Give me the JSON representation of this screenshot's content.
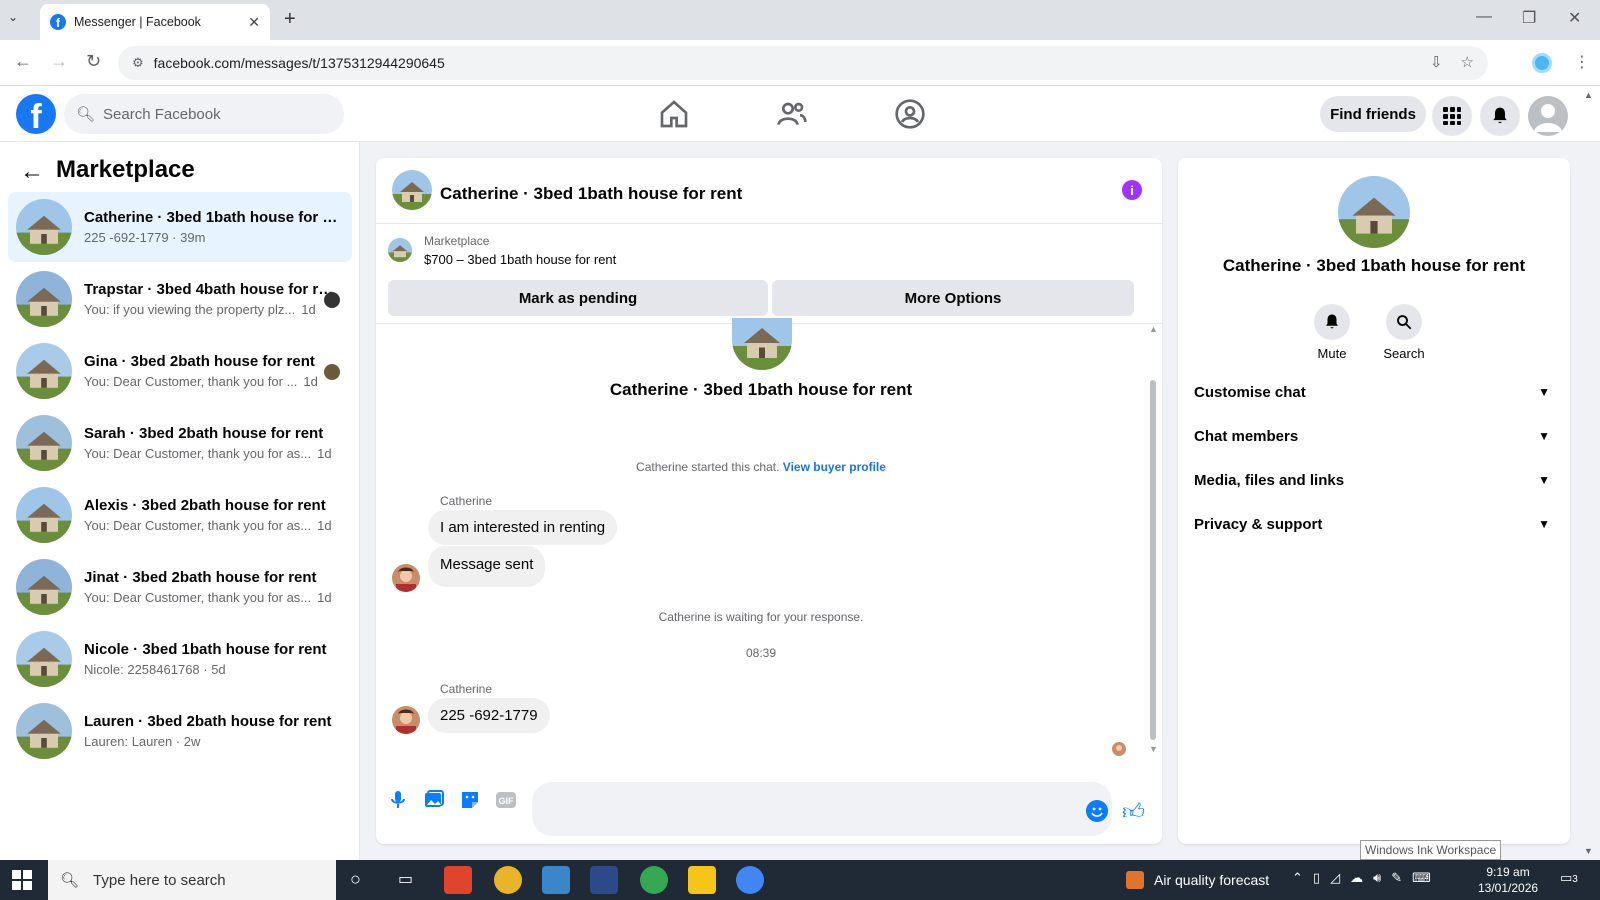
{
  "browser": {
    "tab_title": "Messenger | Facebook",
    "url": "facebook.com/messages/t/1375312944290645"
  },
  "fb": {
    "search_placeholder": "Search Facebook",
    "find_friends": "Find friends"
  },
  "marketplace": {
    "title": "Marketplace",
    "conversations": [
      {
        "name": "Catherine · 3bed 1bath house for rent",
        "preview": "225 -692-1779 · 39m"
      },
      {
        "name": "Trapstar · 3bed 4bath house for rent",
        "preview": "You: if you viewing the property plz...",
        "time": "1d"
      },
      {
        "name": "Gina · 3bed 2bath house for rent",
        "preview": "You: Dear Customer, thank you for ...",
        "time": "1d"
      },
      {
        "name": "Sarah · 3bed 2bath house for rent",
        "preview": "You: Dear Customer, thank you for as...",
        "time": "1d"
      },
      {
        "name": "Alexis · 3bed 2bath house for rent",
        "preview": "You: Dear Customer, thank you for as...",
        "time": "1d"
      },
      {
        "name": "Jinat · 3bed 2bath house for rent",
        "preview": "You: Dear Customer, thank you for as...",
        "time": "1d"
      },
      {
        "name": "Nicole · 3bed 1bath house for rent",
        "preview": "Nicole: 2258461768 · 5d"
      },
      {
        "name": "Lauren · 3bed 2bath house for rent",
        "preview": "Lauren: Lauren · 2w"
      }
    ]
  },
  "chat": {
    "title": "Catherine · 3bed 1bath house for rent",
    "listing_label": "Marketplace",
    "listing_price": "$700 – 3bed 1bath house for rent",
    "btn_pending": "Mark as pending",
    "btn_more": "More Options",
    "started_text": "Catherine started this chat.",
    "view_buyer": "View buyer profile",
    "sender1": "Catherine",
    "msg1": "I am interested in renting",
    "msg2": "Message sent",
    "waiting": "Catherine is waiting for your response.",
    "time_sep": "08:39",
    "sender2": "Catherine",
    "msg3": "225 -692-1779"
  },
  "details": {
    "title": "Catherine · 3bed 1bath house for rent",
    "mute": "Mute",
    "search": "Search",
    "sections": [
      "Customise chat",
      "Chat members",
      "Media, files and links",
      "Privacy & support"
    ]
  },
  "taskbar": {
    "search_placeholder": "Type here to search",
    "weather": "Air quality forecast",
    "time": "9:19 am",
    "date": "13/01/2026",
    "notif_count": "3"
  },
  "tooltip": "Windows Ink Workspace"
}
